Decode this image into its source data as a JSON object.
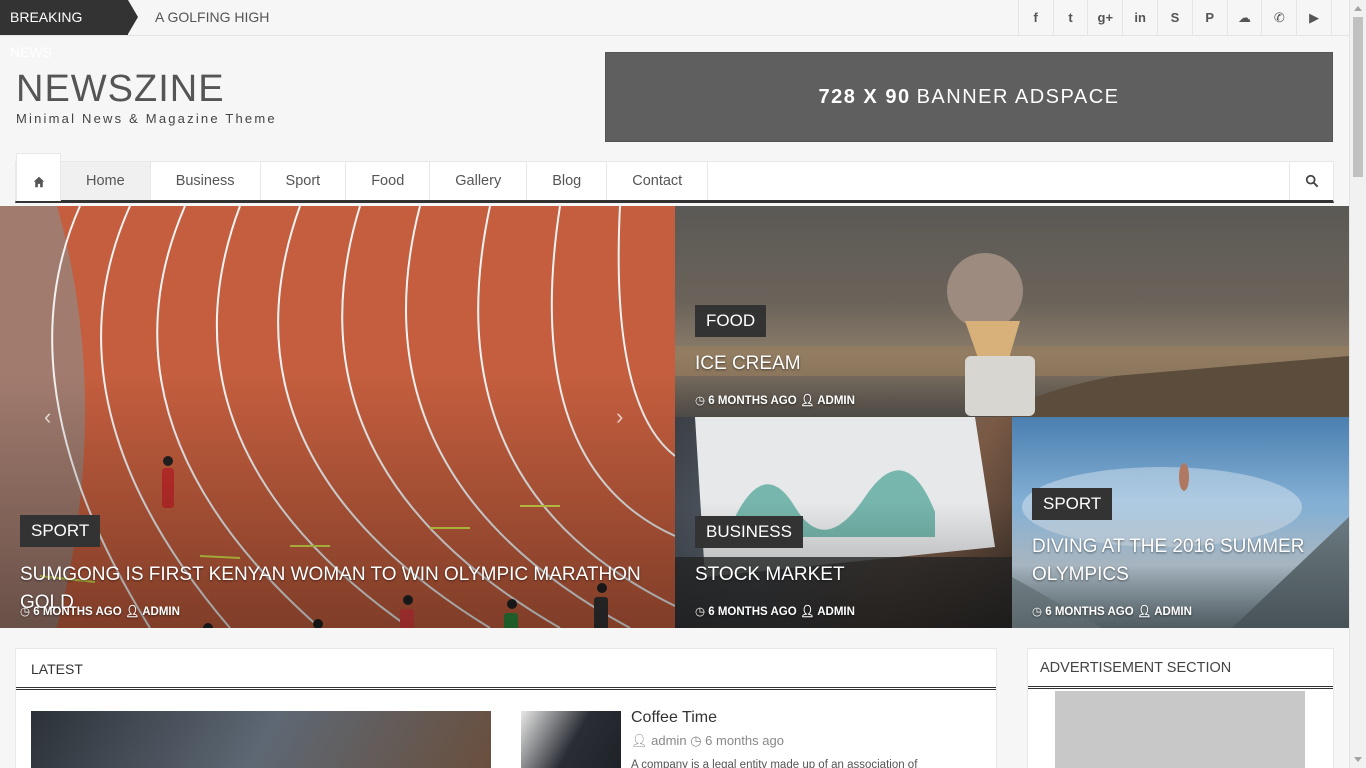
{
  "topbar": {
    "breaking_label": "BREAKING NEWS",
    "ticker_text": "A GOLFING HIGH",
    "social_icons": [
      "facebook-icon",
      "twitter-icon",
      "google-plus-icon",
      "linkedin-icon",
      "skype-icon",
      "pinterest-icon",
      "soundcloud-icon",
      "whatsapp-icon",
      "youtube-icon"
    ],
    "social_glyphs": [
      "f",
      "t",
      "g+",
      "in",
      "S",
      "P",
      "☁",
      "✆",
      "▶"
    ]
  },
  "header": {
    "logo": "NEWSZINE",
    "tagline": "Minimal News & Magazine Theme",
    "banner_bold": "728 X 90",
    "banner_text": "BANNER ADSPACE"
  },
  "nav": {
    "items": [
      "Home",
      "Business",
      "Sport",
      "Food",
      "Gallery",
      "Blog",
      "Contact"
    ]
  },
  "hero": {
    "main": {
      "category": "SPORT",
      "title": "SUMGONG IS FIRST KENYAN WOMAN TO WIN OLYMPIC MARATHON GOLD",
      "time": "6 MONTHS AGO",
      "author": "ADMIN"
    },
    "food": {
      "category": "FOOD",
      "title": "ICE CREAM",
      "time": "6 MONTHS AGO",
      "author": "ADMIN"
    },
    "business": {
      "category": "BUSINESS",
      "title": "STOCK MARKET",
      "time": "6 MONTHS AGO",
      "author": "ADMIN"
    },
    "sport2": {
      "category": "SPORT",
      "title": "DIVING AT THE 2016 SUMMER OLYMPICS",
      "time": "6 MONTHS AGO",
      "author": "ADMIN"
    },
    "prev_arrow": "‹",
    "next_arrow": "›"
  },
  "latest": {
    "heading": "LATEST",
    "post": {
      "title": "Coffee Time",
      "author": "admin",
      "time": "6 months ago",
      "excerpt": "A company is a legal entity made up of an association of"
    }
  },
  "sidebar": {
    "ad_heading": "ADVERTISEMENT SECTION"
  }
}
